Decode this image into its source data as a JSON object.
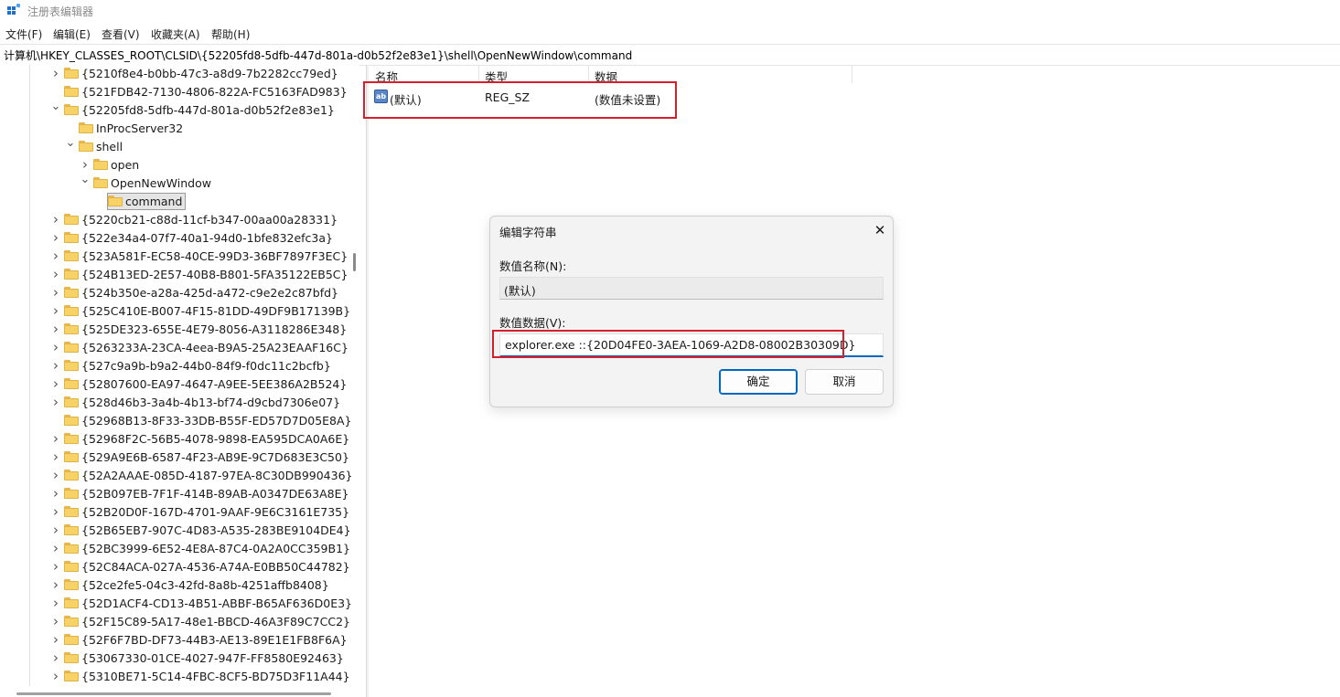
{
  "window": {
    "title": "注册表编辑器"
  },
  "menu": [
    "文件(F)",
    "编辑(E)",
    "查看(V)",
    "收藏夹(A)",
    "帮助(H)"
  ],
  "address": "计算机\\HKEY_CLASSES_ROOT\\CLSID\\{52205fd8-5dfb-447d-801a-d0b52f2e83e1}\\shell\\OpenNewWindow\\command",
  "tree": [
    {
      "label": "{5210f8e4-b0bb-47c3-a8d9-7b2282cc79ed}",
      "level": 0,
      "chevron": "collapsed"
    },
    {
      "label": "{521FDB42-7130-4806-822A-FC5163FAD983}",
      "level": 0,
      "chevron": "none"
    },
    {
      "label": "{52205fd8-5dfb-447d-801a-d0b52f2e83e1}",
      "level": 0,
      "chevron": "expanded"
    },
    {
      "label": "InProcServer32",
      "level": 1,
      "chevron": "none"
    },
    {
      "label": "shell",
      "level": 1,
      "chevron": "expanded"
    },
    {
      "label": "open",
      "level": 2,
      "chevron": "collapsed"
    },
    {
      "label": "OpenNewWindow",
      "level": 2,
      "chevron": "expanded"
    },
    {
      "label": "command",
      "level": 3,
      "chevron": "none",
      "selected": true
    },
    {
      "label": "{5220cb21-c88d-11cf-b347-00aa00a28331}",
      "level": 0,
      "chevron": "collapsed"
    },
    {
      "label": "{522e34a4-07f7-40a1-94d0-1bfe832efc3a}",
      "level": 0,
      "chevron": "collapsed"
    },
    {
      "label": "{523A581F-EC58-40CE-99D3-36BF7897F3EC}",
      "level": 0,
      "chevron": "collapsed"
    },
    {
      "label": "{524B13ED-2E57-40B8-B801-5FA35122EB5C}",
      "level": 0,
      "chevron": "collapsed"
    },
    {
      "label": "{524b350e-a28a-425d-a472-c9e2e2c87bfd}",
      "level": 0,
      "chevron": "collapsed"
    },
    {
      "label": "{525C410E-B007-4F15-81DD-49DF9B17139B}",
      "level": 0,
      "chevron": "collapsed"
    },
    {
      "label": "{525DE323-655E-4E79-8056-A3118286E348}",
      "level": 0,
      "chevron": "collapsed"
    },
    {
      "label": "{5263233A-23CA-4eea-B9A5-25A23EAAF16C}",
      "level": 0,
      "chevron": "collapsed"
    },
    {
      "label": "{527c9a9b-b9a2-44b0-84f9-f0dc11c2bcfb}",
      "level": 0,
      "chevron": "collapsed"
    },
    {
      "label": "{52807600-EA97-4647-A9EE-5EE386A2B524}",
      "level": 0,
      "chevron": "collapsed"
    },
    {
      "label": "{528d46b3-3a4b-4b13-bf74-d9cbd7306e07}",
      "level": 0,
      "chevron": "collapsed"
    },
    {
      "label": "{52968B13-8F33-33DB-B55F-ED57D7D05E8A}",
      "level": 0,
      "chevron": "none"
    },
    {
      "label": "{52968F2C-56B5-4078-9898-EA595DCA0A6E}",
      "level": 0,
      "chevron": "collapsed"
    },
    {
      "label": "{529A9E6B-6587-4F23-AB9E-9C7D683E3C50}",
      "level": 0,
      "chevron": "collapsed"
    },
    {
      "label": "{52A2AAAE-085D-4187-97EA-8C30DB990436}",
      "level": 0,
      "chevron": "collapsed"
    },
    {
      "label": "{52B097EB-7F1F-414B-89AB-A0347DE63A8E}",
      "level": 0,
      "chevron": "collapsed"
    },
    {
      "label": "{52B20D0F-167D-4701-9AAF-9E6C3161E735}",
      "level": 0,
      "chevron": "collapsed"
    },
    {
      "label": "{52B65EB7-907C-4D83-A535-283BE9104DE4}",
      "level": 0,
      "chevron": "collapsed"
    },
    {
      "label": "{52BC3999-6E52-4E8A-87C4-0A2A0CC359B1}",
      "level": 0,
      "chevron": "collapsed"
    },
    {
      "label": "{52C84ACA-027A-4536-A74A-E0BB50C44782}",
      "level": 0,
      "chevron": "collapsed"
    },
    {
      "label": "{52ce2fe5-04c3-42fd-8a8b-4251affb8408}",
      "level": 0,
      "chevron": "collapsed"
    },
    {
      "label": "{52D1ACF4-CD13-4B51-ABBF-B65AF636D0E3}",
      "level": 0,
      "chevron": "collapsed"
    },
    {
      "label": "{52F15C89-5A17-48e1-BBCD-46A3F89C7CC2}",
      "level": 0,
      "chevron": "collapsed"
    },
    {
      "label": "{52F6F7BD-DF73-44B3-AE13-89E1E1FB8F6A}",
      "level": 0,
      "chevron": "collapsed"
    },
    {
      "label": "{53067330-01CE-4027-947F-FF8580E92463}",
      "level": 0,
      "chevron": "collapsed"
    },
    {
      "label": "{5310BE71-5C14-4FBC-8CF5-BD75D3F11A44}",
      "level": 0,
      "chevron": "collapsed"
    }
  ],
  "values_pane": {
    "columns": [
      "名称",
      "类型",
      "数据"
    ],
    "rows": [
      {
        "icon": "string-value-icon",
        "icon_text": "ab",
        "name": "(默认)",
        "type": "REG_SZ",
        "data": "(数值未设置)"
      }
    ]
  },
  "dialog": {
    "title": "编辑字符串",
    "name_label": "数值名称(N):",
    "name_value": "(默认)",
    "data_label": "数值数据(V):",
    "data_value": "explorer.exe ::{20D04FE0-3AEA-1069-A2D8-08002B30309D}",
    "ok_label": "确定",
    "cancel_label": "取消"
  },
  "colors": {
    "highlight": "#d4202c",
    "accent": "#0067c0",
    "folder": "#f7d266"
  }
}
